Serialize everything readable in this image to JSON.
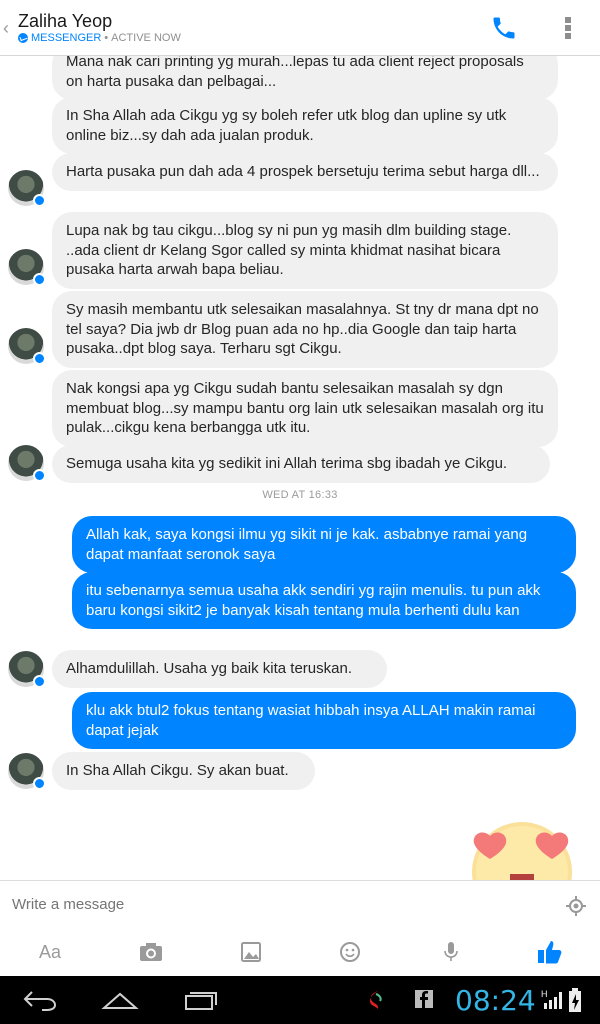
{
  "header": {
    "contact_name": "Zaliha Yeop",
    "platform": "MESSENGER",
    "separator": "•",
    "status": "ACTIVE NOW",
    "icons": [
      "back-chevron-icon",
      "phone-icon",
      "more-vert-icon",
      "messenger-icon"
    ]
  },
  "messages": [
    {
      "dir": "in",
      "text": "Mana nak cari printing yg murah...lepas tu ada client reject proposals on harta pusaka dan pelbagai..."
    },
    {
      "dir": "in",
      "text": "In Sha Allah ada Cikgu yg sy boleh refer utk blog dan upline sy utk online biz...sy dah ada jualan produk."
    },
    {
      "dir": "in",
      "text": "Harta pusaka pun dah ada 4 prospek bersetuju terima sebut harga dll..."
    },
    {
      "dir": "in",
      "text": "Lupa nak bg tau cikgu...blog sy ni pun yg masih dlm building stage. ..ada client dr Kelang Sgor called sy minta khidmat nasihat bicara pusaka harta arwah bapa beliau."
    },
    {
      "dir": "in",
      "text": "Sy masih membantu utk selesaikan masalahnya. St tny dr mana dpt no tel saya? Dia jwb dr Blog puan ada no hp..dia Google dan taip harta pusaka..dpt blog saya. Terharu sgt Cikgu."
    },
    {
      "dir": "in",
      "text": "Nak kongsi apa yg Cikgu sudah bantu selesaikan masalah sy dgn membuat blog...sy mampu bantu org lain utk selesaikan masalah org itu pulak...cikgu kena berbangga utk itu."
    },
    {
      "dir": "in",
      "text": "Semuga usaha kita yg sedikit ini Allah terima sbg ibadah ye Cikgu."
    },
    {
      "dir": "out",
      "text": "Allah kak, saya kongsi ilmu yg sikit ni je kak. asbabnye ramai yang dapat manfaat seronok saya"
    },
    {
      "dir": "out",
      "text": "itu sebenarnya semua usaha akk sendiri yg rajin menulis. tu pun akk baru kongsi sikit2 je banyak kisah tentang mula berhenti dulu kan"
    },
    {
      "dir": "in",
      "text": "Alhamdulillah. Usaha yg baik kita teruskan."
    },
    {
      "dir": "out",
      "text": "klu akk btul2 fokus tentang wasiat hibbah insya ALLAH makin ramai dapat jejak"
    },
    {
      "dir": "in",
      "text": "In Sha Allah Cikgu. Sy akan buat."
    }
  ],
  "timestamp": "WED AT 16:33",
  "composer": {
    "placeholder": "Write a message",
    "aa_label": "Aa",
    "tools": [
      "text-format",
      "camera-icon",
      "gallery-icon",
      "emoji-icon",
      "microphone-icon",
      "thumbs-up-icon"
    ]
  },
  "system": {
    "clock": "08:24"
  },
  "colors": {
    "accent": "#0084ff",
    "incoming_bubble": "#f1f0f0",
    "clock": "#33b5e5"
  }
}
